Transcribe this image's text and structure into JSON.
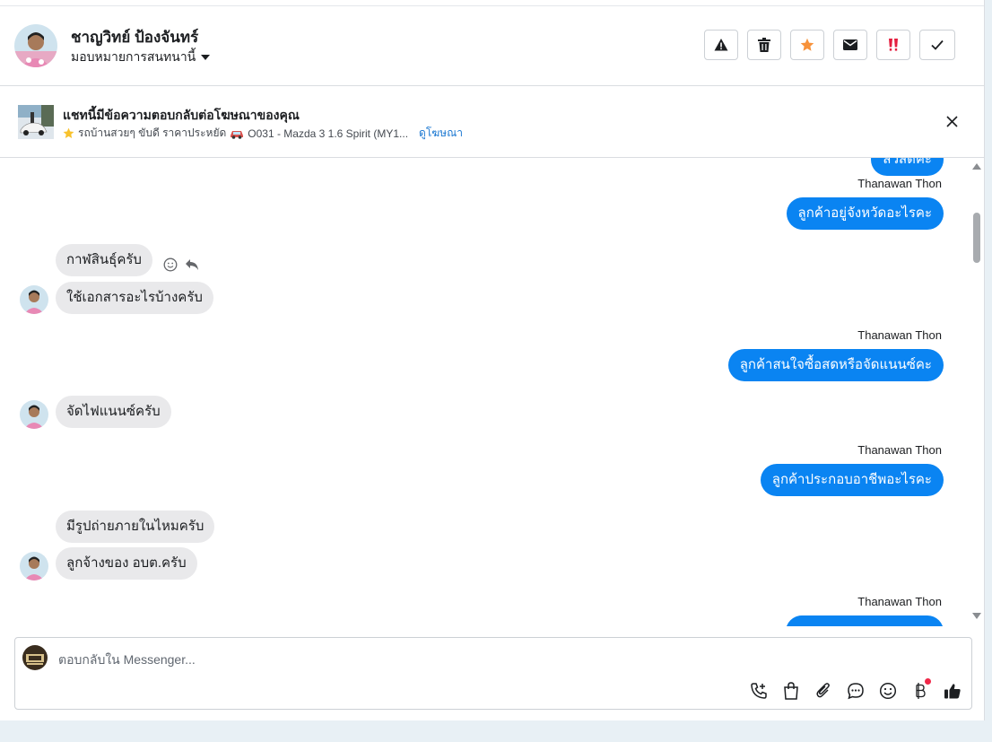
{
  "header": {
    "contact_name": "ชาญวิทย์ ป้องจันทร์",
    "assign_label": "มอบหมายการสนทนานี้",
    "actions": [
      "spam-icon",
      "trash-icon",
      "star-icon",
      "mark-unread-icon",
      "important-icon",
      "done-icon"
    ]
  },
  "ad_banner": {
    "title": "แชทนี้มีข้อความตอบกลับต่อโฆษณาของคุณ",
    "ad_text": "รถบ้านสวยๆ ขับดี ราคาประหยัด",
    "ad_code": "O031 - Mazda 3 1.6 Spirit (MY1...",
    "link_label": "ดูโฆษณา"
  },
  "messages": [
    {
      "dir": "out",
      "text": "สวัสดีค่ะ"
    },
    {
      "sender": "Thanawan Thon"
    },
    {
      "dir": "out",
      "text": "ลูกค้าอยู่จังหวัดอะไรคะ"
    },
    {
      "dir": "in",
      "text": "กาฬสินธุ์ครับ"
    },
    {
      "dir": "in",
      "text": "ใช้เอกสารอะไรบ้างครับ"
    },
    {
      "sender": "Thanawan Thon"
    },
    {
      "dir": "out",
      "text": "ลูกค้าสนใจซื้อสดหรือจัดแนนซ์คะ"
    },
    {
      "dir": "in",
      "text": "จัดไฟแนนซ์ครับ"
    },
    {
      "sender": "Thanawan Thon"
    },
    {
      "dir": "out",
      "text": "ลูกค้าประกอบอาชีพอะไรคะ"
    },
    {
      "dir": "in",
      "text": "มีรูปถ่ายภายในไหมครับ"
    },
    {
      "dir": "in",
      "text": "ลูกจ้างของ อบต.ครับ"
    },
    {
      "sender": "Thanawan Thon"
    }
  ],
  "composer": {
    "placeholder": "ตอบกลับใน Messenger...",
    "tools": [
      "call-add-icon",
      "shopping-bag-icon",
      "attachment-icon",
      "saved-reply-icon",
      "emoji-icon",
      "baht-payment-icon",
      "like-icon"
    ]
  },
  "colors": {
    "outgoing_bubble": "#0a84f2",
    "incoming_bubble": "#e9e9eb",
    "link": "#1876d1",
    "important": "#e41e3f",
    "star": "#f7923b"
  }
}
